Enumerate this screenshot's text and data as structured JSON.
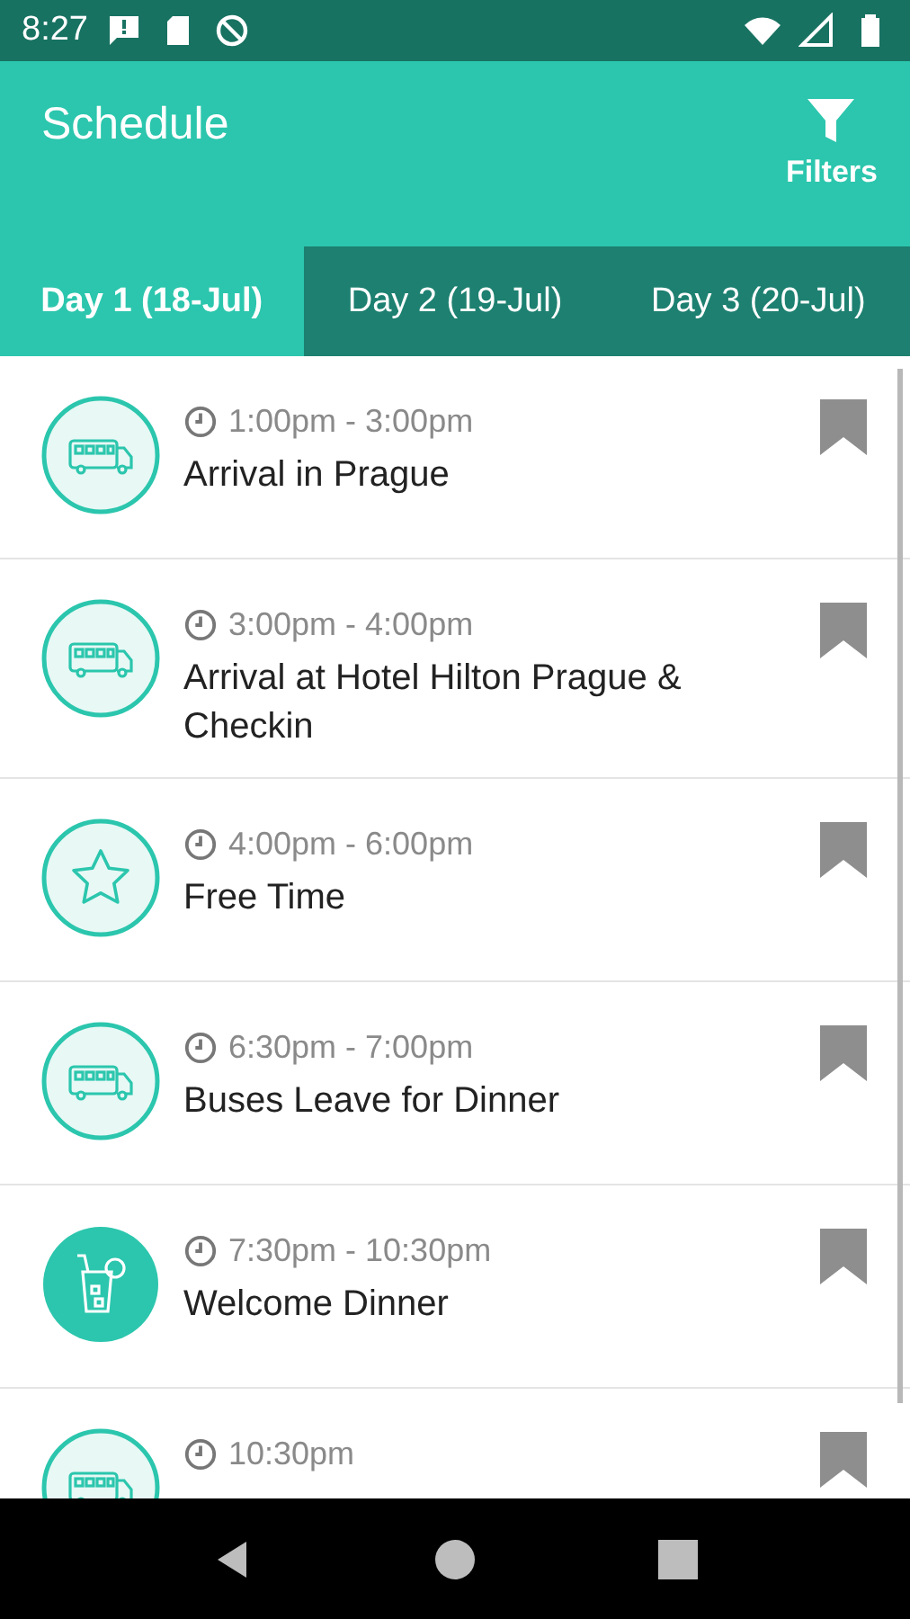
{
  "status_bar": {
    "time": "8:27"
  },
  "header": {
    "title": "Schedule",
    "filter_button": "Filters"
  },
  "tabs": [
    {
      "label": "Day 1 (18-Jul)",
      "selected": true
    },
    {
      "label": "Day 2 (19-Jul)",
      "selected": false
    },
    {
      "label": "Day 3 (20-Jul)",
      "selected": false
    }
  ],
  "events": [
    {
      "kind": "bus",
      "time": "1:00pm - 3:00pm",
      "title": "Arrival in Prague"
    },
    {
      "kind": "bus",
      "time": "3:00pm - 4:00pm",
      "title": "Arrival at Hotel Hilton Prague & Checkin"
    },
    {
      "kind": "star",
      "time": "4:00pm - 6:00pm",
      "title": "Free Time"
    },
    {
      "kind": "bus",
      "time": "6:30pm - 7:00pm",
      "title": "Buses Leave for Dinner"
    },
    {
      "kind": "drink",
      "time": "7:30pm - 10:30pm",
      "title": "Welcome Dinner"
    },
    {
      "kind": "bus",
      "time": "10:30pm"
    }
  ]
}
